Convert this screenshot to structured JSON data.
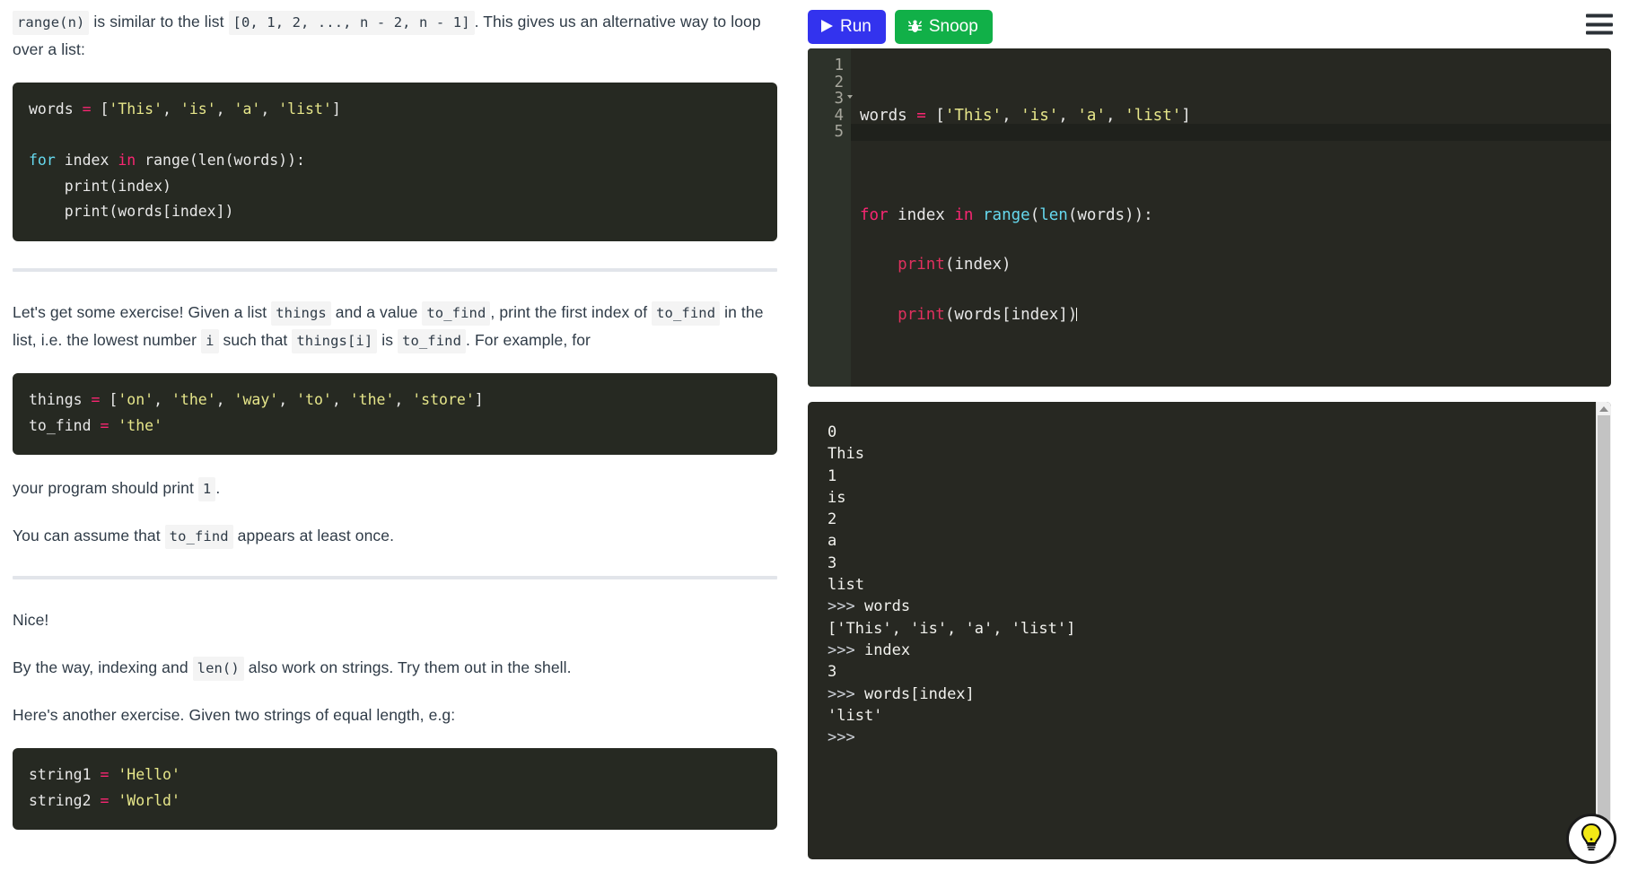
{
  "tutorial": {
    "paragraph_1": {
      "seg_1_code": "range(n)",
      "seg_2_text": " is similar to the list ",
      "seg_3_code": "[0, 1, 2, ..., n - 2, n - 1]",
      "seg_4_text": ". This gives us an alternative way to loop over a list:"
    },
    "code_block_1": {
      "line_1_a": "words",
      "line_1_op": "=",
      "line_1_b": " [",
      "line_1_s1": "'This'",
      "line_1_c1": ", ",
      "line_1_s2": "'is'",
      "line_1_c2": ", ",
      "line_1_s3": "'a'",
      "line_1_c3": ", ",
      "line_1_s4": "'list'",
      "line_1_end": "]",
      "line_2": "",
      "line_3_kw": "for",
      "line_3_var": " index ",
      "line_3_in": "in",
      "line_3_rest": " range(len(words)):",
      "line_4": "    print(index)",
      "line_5": "    print(words[index])"
    },
    "paragraph_2": {
      "t1": "Let's get some exercise! Given a list ",
      "c1": "things",
      "t2": " and a value ",
      "c2": "to_find",
      "t3": ", print the first index of ",
      "c3": "to_find",
      "t4": " in the list, i.e. the lowest number ",
      "c4": "i",
      "t5": " such that ",
      "c5": "things[i]",
      "t6": " is ",
      "c6": "to_find",
      "t7": ". For example, for"
    },
    "code_block_2": {
      "l1_a": "things",
      "l1_op": "=",
      "l1_b": " [",
      "l1_s1": "'on'",
      "l1_c1": ", ",
      "l1_s2": "'the'",
      "l1_c2": ", ",
      "l1_s3": "'way'",
      "l1_c3": ", ",
      "l1_s4": "'to'",
      "l1_c4": ", ",
      "l1_s5": "'the'",
      "l1_c5": ", ",
      "l1_s6": "'store'",
      "l1_end": "]",
      "l2_a": "to_find ",
      "l2_op": "=",
      "l2_b": " ",
      "l2_s1": "'the'"
    },
    "paragraph_3": {
      "t1": "your program should print ",
      "c1": "1",
      "t2": "."
    },
    "paragraph_4": {
      "t1": "You can assume that ",
      "c1": "to_find",
      "t2": " appears at least once."
    },
    "paragraph_5": {
      "t1": "Nice!"
    },
    "paragraph_6": {
      "t1": "By the way, indexing and ",
      "c1": "len()",
      "t2": " also work on strings. Try them out in the shell."
    },
    "paragraph_7": {
      "t1": "Here's another exercise. Given two strings of equal length, e.g:"
    },
    "code_block_3": {
      "l1_a": "string1 ",
      "l1_op": "=",
      "l1_b": " ",
      "l1_s1": "'Hello'",
      "l2_a": "string2 ",
      "l2_op": "=",
      "l2_b": " ",
      "l2_s1": "'World'"
    }
  },
  "toolbar": {
    "run_label": "Run",
    "snoop_label": "Snoop",
    "run_icon": "play-icon",
    "snoop_icon": "bug-icon",
    "menu_icon": "hamburger-menu-icon",
    "run_color": "#3333ee",
    "snoop_color": "#11b048"
  },
  "editor": {
    "line_numbers": [
      "1",
      "2",
      "3",
      "4",
      "5"
    ],
    "active_line": "5",
    "fold_line": "3",
    "lines": {
      "l1_a": "words ",
      "l1_op": "=",
      "l1_b": " [",
      "l1_s1": "'This'",
      "l1_c1": ", ",
      "l1_s2": "'is'",
      "l1_c2": ", ",
      "l1_s3": "'a'",
      "l1_c3": ", ",
      "l1_s4": "'list'",
      "l1_end": "]",
      "l2": "",
      "l3_kw": "for",
      "l3_var": " index ",
      "l3_in": "in",
      "l3_sp": " ",
      "l3_fn1": "range",
      "l3_p1": "(",
      "l3_fn2": "len",
      "l3_rest": "(words)):",
      "l4_ind": "    ",
      "l4_fn": "print",
      "l4_rest": "(index)",
      "l5_ind": "    ",
      "l5_fn": "print",
      "l5_rest": "(words[index])"
    }
  },
  "console": {
    "lines": [
      {
        "prompt": "",
        "text": "0"
      },
      {
        "prompt": "",
        "text": "This"
      },
      {
        "prompt": "",
        "text": "1"
      },
      {
        "prompt": "",
        "text": "is"
      },
      {
        "prompt": "",
        "text": "2"
      },
      {
        "prompt": "",
        "text": "a"
      },
      {
        "prompt": "",
        "text": "3"
      },
      {
        "prompt": "",
        "text": "list"
      },
      {
        "prompt": ">>> ",
        "text": "words"
      },
      {
        "prompt": "",
        "text": "['This', 'is', 'a', 'list']"
      },
      {
        "prompt": ">>> ",
        "text": "index"
      },
      {
        "prompt": "",
        "text": "3"
      },
      {
        "prompt": ">>> ",
        "text": "words[index]"
      },
      {
        "prompt": "",
        "text": "'list'"
      },
      {
        "prompt": ">>> ",
        "text": ""
      }
    ]
  },
  "help": {
    "icon": "lightbulb-icon",
    "bulb_color": "#f2e816"
  }
}
